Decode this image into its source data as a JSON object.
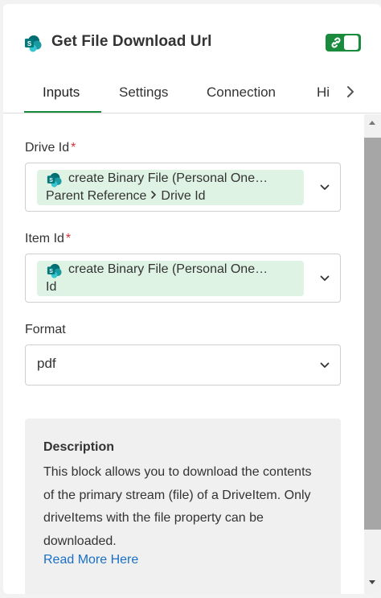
{
  "header": {
    "title": "Get File Download Url",
    "app_icon": "sharepoint-icon",
    "toggle_icon": "link-icon",
    "toggle_on": true,
    "accent_color": "#1a8a3c"
  },
  "tabs": [
    {
      "label": "Inputs",
      "active": true
    },
    {
      "label": "Settings",
      "active": false
    },
    {
      "label": "Connection",
      "active": false
    },
    {
      "label": "Hi",
      "active": false
    }
  ],
  "fields": {
    "drive_id": {
      "label": "Drive Id",
      "required_mark": "*",
      "token_title": "create Binary File (Personal One…",
      "token_path": [
        "Parent Reference",
        "Drive Id"
      ]
    },
    "item_id": {
      "label": "Item Id",
      "required_mark": "*",
      "token_title": "create Binary File (Personal One…",
      "token_path": [
        "Id"
      ]
    },
    "format": {
      "label": "Format",
      "value": "pdf"
    }
  },
  "description": {
    "title": "Description",
    "body": "This block allows you to download the contents of the primary stream (file) of a DriveItem. Only driveItems with the file property can be downloaded.",
    "link": "Read More Here"
  }
}
